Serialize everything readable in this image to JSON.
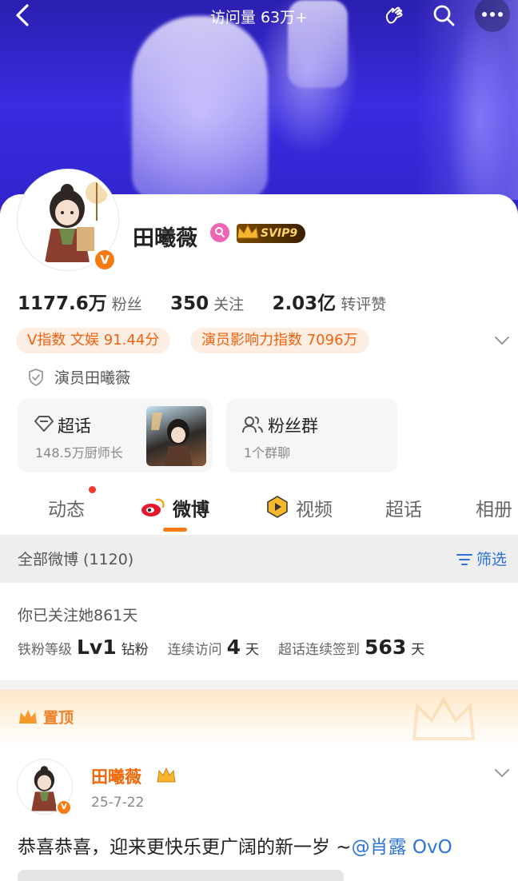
{
  "header": {
    "title": "访问量 63万+"
  },
  "profile": {
    "name": "田曦薇",
    "svip": "SVIP9",
    "verified_badge": "V",
    "stats": [
      {
        "value": "1177.6万",
        "label": "粉丝"
      },
      {
        "value": "350",
        "label": "关注"
      },
      {
        "value": "2.03亿",
        "label": "转评赞"
      }
    ],
    "pills": {
      "v_index": "V指数 文娱 91.44分",
      "actor_index": "演员影响力指数 7096万"
    },
    "verification": "演员田曦薇"
  },
  "boxes": {
    "supertopic": {
      "title": "超话",
      "subtitle": "148.5万厨师长"
    },
    "fangroup": {
      "title": "粉丝群",
      "subtitle": "1个群聊"
    }
  },
  "tabs": {
    "dynamic": "动态",
    "weibo": "微博",
    "video": "视频",
    "supertopic": "超话",
    "album": "相册"
  },
  "filterbar": {
    "label": "全部微博 (1120)",
    "filter": "筛选"
  },
  "fan_info": {
    "followed_days": "你已关注她861天",
    "level_label": "铁粉等级",
    "level_value": "Lv1",
    "level_unit": "钻粉",
    "visit_label": "连续访问",
    "visit_value": "4",
    "visit_unit": "天",
    "checkin_label": "超话连续签到",
    "checkin_value": "563",
    "checkin_unit": "天"
  },
  "pinned": {
    "label": "置顶"
  },
  "post": {
    "author": "田曦薇",
    "date": "25-7-22",
    "text": "恭喜恭喜，迎来更快乐更广阔的新一岁 ~",
    "mention": "@肖露 OvO"
  },
  "colors": {
    "accent_orange": "#f57b12",
    "link_blue": "#2b73d6",
    "banner_blue": "#3a2ce0"
  }
}
